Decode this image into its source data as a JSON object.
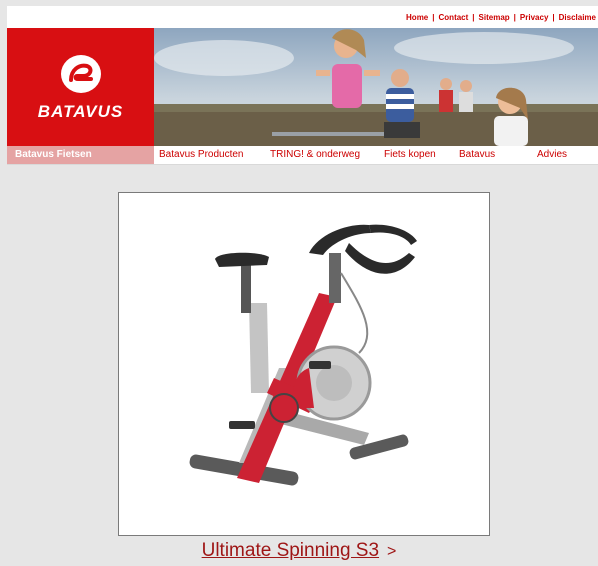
{
  "toplinks": {
    "items": [
      "Home",
      "Contact",
      "Sitemap",
      "Privacy",
      "Disclaime"
    ],
    "separator": "|"
  },
  "brand": {
    "name": "BATAVUS"
  },
  "nav": {
    "items": [
      {
        "label": "Batavus Fietsen",
        "active": true
      },
      {
        "label": "Batavus Producten",
        "active": false
      },
      {
        "label": "TRING! & onderweg",
        "active": false
      },
      {
        "label": "Fiets kopen",
        "active": false
      },
      {
        "label": "Batavus",
        "active": false
      },
      {
        "label": "Advies",
        "active": false
      }
    ]
  },
  "product": {
    "name": "Ultimate Spinning S3",
    "arrow": ">"
  },
  "colors": {
    "brand_red": "#d80f12",
    "link_red": "#9e1515",
    "nav_active_bg": "#e5a3a3",
    "page_bg": "#e6e6e6"
  }
}
